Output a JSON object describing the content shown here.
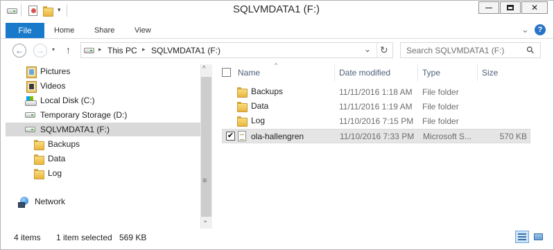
{
  "window": {
    "title": "SQLVMDATA1 (F:)",
    "minimize_glyph": "—",
    "maximize_glyph": "☐",
    "close_glyph": "✕"
  },
  "ribbon": {
    "tabs": [
      "File",
      "Home",
      "Share",
      "View"
    ],
    "expand_glyph": "⌄",
    "help_glyph": "?"
  },
  "address": {
    "back_glyph": "←",
    "forward_glyph": "→",
    "up_glyph": "↑",
    "crumbs": [
      "This PC",
      "SQLVMDATA1 (F:)"
    ],
    "separator": "▸",
    "dropdown_glyph": "⌄",
    "refresh_glyph": "↻",
    "search_placeholder": "Search SQLVMDATA1 (F:)",
    "search_glyph": "⚲"
  },
  "nav": {
    "items": [
      {
        "label": "Pictures",
        "icon": "pictures-library-icon"
      },
      {
        "label": "Videos",
        "icon": "videos-library-icon"
      },
      {
        "label": "Local Disk (C:)",
        "icon": "windows-drive-icon"
      },
      {
        "label": "Temporary Storage (D:)",
        "icon": "drive-icon"
      },
      {
        "label": "SQLVMDATA1 (F:)",
        "icon": "drive-icon",
        "selected": true
      },
      {
        "label": "Backups",
        "icon": "folder-icon"
      },
      {
        "label": "Data",
        "icon": "folder-icon"
      },
      {
        "label": "Log",
        "icon": "folder-icon"
      },
      {
        "label": "Network",
        "icon": "network-icon"
      }
    ],
    "scroll_up_glyph": "^",
    "scroll_down_glyph": "⌄",
    "grip_glyph": "≡"
  },
  "list": {
    "sort_glyph": "^",
    "columns": [
      "Name",
      "Date modified",
      "Type",
      "Size"
    ],
    "rows": [
      {
        "name": "Backups",
        "date": "11/11/2016 1:18 AM",
        "type": "File folder",
        "size": "",
        "icon": "folder-icon"
      },
      {
        "name": "Data",
        "date": "11/11/2016 1:19 AM",
        "type": "File folder",
        "size": "",
        "icon": "folder-icon"
      },
      {
        "name": "Log",
        "date": "11/10/2016 7:15 PM",
        "type": "File folder",
        "size": "",
        "icon": "folder-icon"
      },
      {
        "name": "ola-hallengren",
        "date": "11/10/2016 7:33 PM",
        "type": "Microsoft S...",
        "size": "570 KB",
        "icon": "sql-script-file-icon",
        "selected": true
      }
    ],
    "check_glyph": "✔"
  },
  "status": {
    "items_count": "4 items",
    "selection": "1 item selected",
    "selection_size": "569 KB"
  },
  "colors": {
    "file_tab": "#1979ca",
    "selection": "#e5e5e5",
    "folder": "#e8b63c"
  }
}
